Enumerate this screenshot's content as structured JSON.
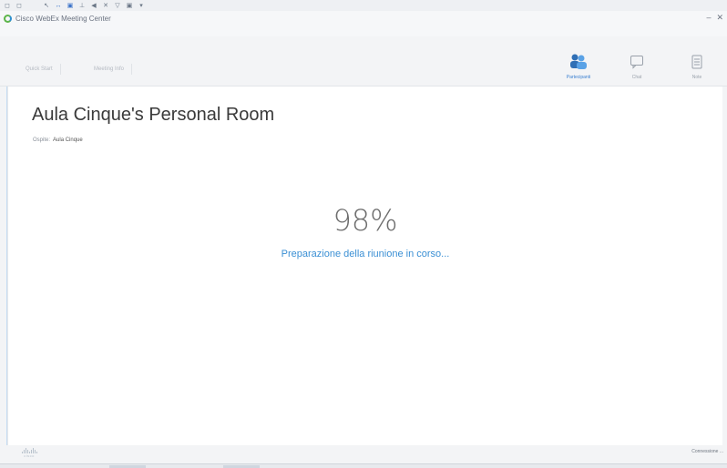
{
  "remote_toolbar": {
    "buttons": [
      "◻",
      "◻",
      "↖",
      "↔",
      "▣",
      "⊥",
      "◀",
      "✕",
      "▽",
      "▣",
      "▾"
    ]
  },
  "window": {
    "title": "Cisco WebEx Meeting Center",
    "minimize": "–",
    "close": "✕"
  },
  "tabs": {
    "tab1": "Quick Start",
    "tab2": "Meeting Info"
  },
  "panels": {
    "participants": "Partecipanti",
    "chat": "Chat",
    "notes": "Note"
  },
  "room": {
    "title": "Aula Cinque's Personal Room",
    "host_label": "Ospite:",
    "host_name": "Aula Cinque"
  },
  "progress": {
    "percent_text": "98%",
    "status_text": "Preparazione della riunione in corso..."
  },
  "footer": {
    "brand": "cisco",
    "connection_status": "Connessione ..."
  },
  "colors": {
    "accent": "#3a8fd4",
    "title": "#3a3a3a",
    "percent": "#6e6e6e"
  }
}
